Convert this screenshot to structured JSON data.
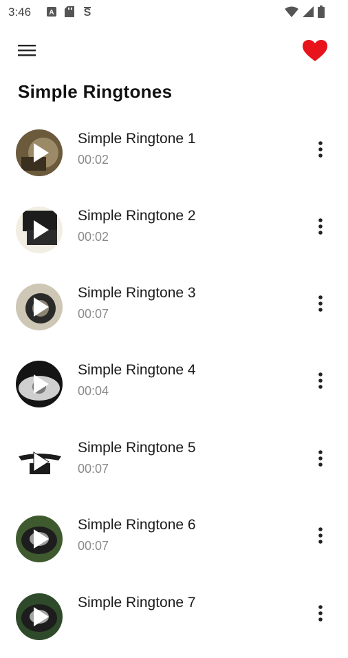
{
  "status_bar": {
    "time": "3:46",
    "left_icons": [
      "a-icon",
      "sd-card-icon",
      "sync-icon"
    ],
    "right_icons": [
      "wifi-icon",
      "signal-icon",
      "battery-icon"
    ]
  },
  "app_bar": {
    "menu_icon": "menu-icon",
    "favorite_icon": "heart-icon",
    "favorite_color": "#e8141c"
  },
  "page": {
    "title": "Simple Ringtones"
  },
  "ringtones": [
    {
      "title": "Simple Ringtone 1",
      "duration": "00:02",
      "thumb_icon": "phone-photo-thumbnail",
      "play_icon": "play-icon",
      "more_icon": "more-vertical-icon"
    },
    {
      "title": "Simple Ringtone 2",
      "duration": "00:02",
      "thumb_icon": "phone-photo-thumbnail",
      "play_icon": "play-icon",
      "more_icon": "more-vertical-icon"
    },
    {
      "title": "Simple Ringtone 3",
      "duration": "00:07",
      "thumb_icon": "phone-photo-thumbnail",
      "play_icon": "play-icon",
      "more_icon": "more-vertical-icon"
    },
    {
      "title": "Simple Ringtone 4",
      "duration": "00:04",
      "thumb_icon": "phone-photo-thumbnail",
      "play_icon": "play-icon",
      "more_icon": "more-vertical-icon"
    },
    {
      "title": "Simple Ringtone 5",
      "duration": "00:07",
      "thumb_icon": "phone-photo-thumbnail",
      "play_icon": "play-icon",
      "more_icon": "more-vertical-icon"
    },
    {
      "title": "Simple Ringtone 6",
      "duration": "00:07",
      "thumb_icon": "phone-photo-thumbnail",
      "play_icon": "play-icon",
      "more_icon": "more-vertical-icon"
    },
    {
      "title": "Simple Ringtone 7",
      "duration": "",
      "thumb_icon": "phone-photo-thumbnail",
      "play_icon": "play-icon",
      "more_icon": "more-vertical-icon"
    }
  ]
}
